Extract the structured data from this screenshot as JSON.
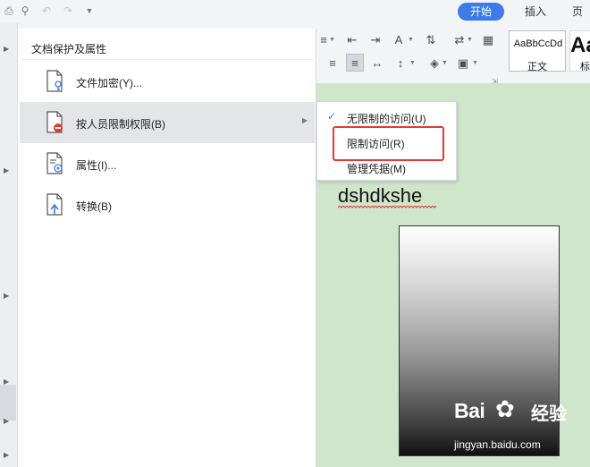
{
  "toolbar": {
    "tabs": {
      "start": "开始",
      "insert": "插入",
      "page": "页面"
    },
    "styles": {
      "preview_text": "AaBbCcDd",
      "normal_label": "正文",
      "second_preview": "Aa",
      "second_label": "标"
    }
  },
  "menu": {
    "title": "文档保护及属性",
    "items": [
      {
        "label": "文件加密(Y)...",
        "icon": "lock-document-icon"
      },
      {
        "label": "按人员限制权限(B)",
        "icon": "restricted-document-icon"
      },
      {
        "label": "属性(I)...",
        "icon": "document-properties-icon"
      },
      {
        "label": "转换(B)",
        "icon": "document-convert-icon"
      }
    ]
  },
  "submenu": {
    "items": [
      {
        "label": "无限制的访问(U)",
        "checked": true
      },
      {
        "label": "限制访问(R)",
        "checked": false
      },
      {
        "label": "管理凭据(M)",
        "checked": false
      }
    ]
  },
  "document": {
    "text": "dshdkshe"
  },
  "watermark": {
    "brand": "Bai",
    "suffix": "经验",
    "url": "jingyan.baidu.com"
  },
  "colors": {
    "accent": "#3b7bea",
    "highlight_box": "#e53935",
    "document_bg": "#cfe6cb"
  }
}
